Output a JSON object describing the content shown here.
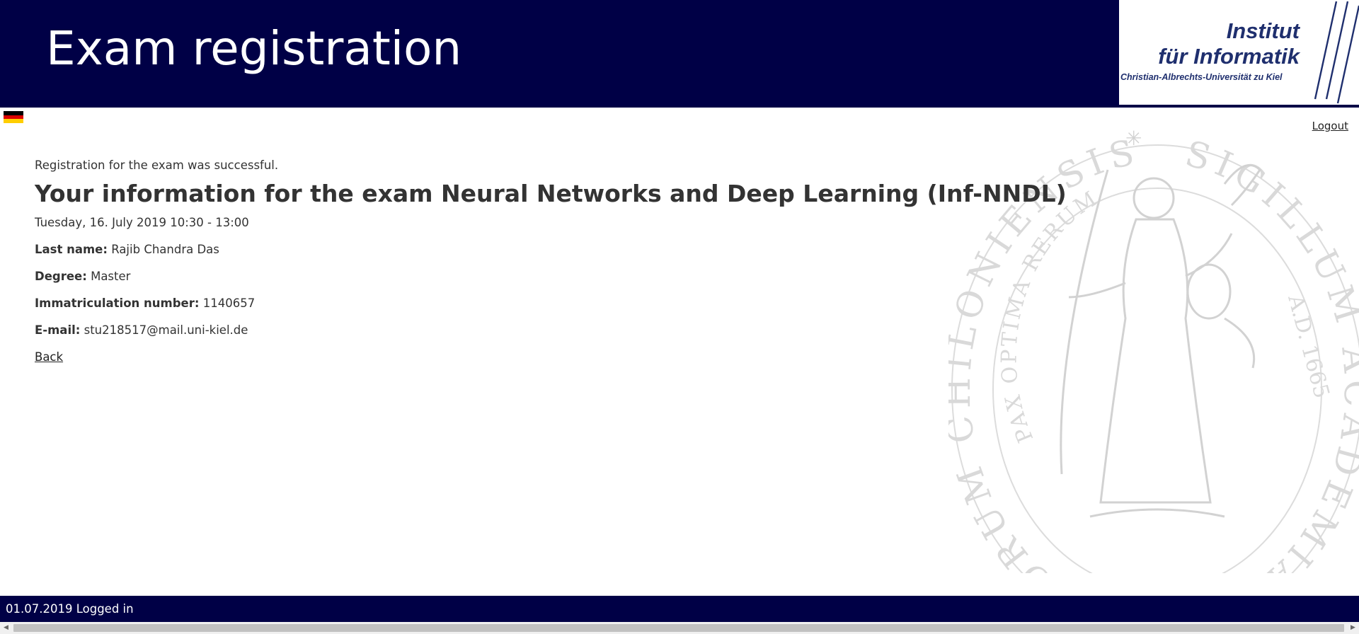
{
  "header": {
    "title": "Exam registration",
    "logo": {
      "line1": "Institut",
      "line2": "für Informatik",
      "line3": "Christian-Albrechts-Universität zu Kiel"
    }
  },
  "language_flag_icon": "german-flag-icon",
  "topbar": {
    "logout_label": "Logout"
  },
  "watermark": {
    "icon": "university-seal-icon",
    "ring_text": "SIGILLUM ACADEMIÆ HOLSATORUM CHILONIENSIS",
    "inner_text": "PAX OPTIMA RERUM",
    "year": "A.D. 1665"
  },
  "main": {
    "success_message": "Registration for the exam was successful.",
    "heading": "Your information for the exam Neural Networks and Deep Learning (Inf-NNDL)",
    "date": "Tuesday, 16. July 2019 10:30 - 13:00",
    "fields": [
      {
        "label": "Last name:",
        "value": "Rajib Chandra Das"
      },
      {
        "label": "Degree:",
        "value": "Master"
      },
      {
        "label": "Immatriculation number:",
        "value": "1140657"
      },
      {
        "label": "E-mail:",
        "value": "stu218517@mail.uni-kiel.de"
      }
    ],
    "back_label": "Back"
  },
  "footer": {
    "status": "01.07.2019 Logged in"
  },
  "colors": {
    "header_bg": "#000046",
    "logo_text": "#1f2f6e",
    "seal": "#d6d6d6"
  }
}
